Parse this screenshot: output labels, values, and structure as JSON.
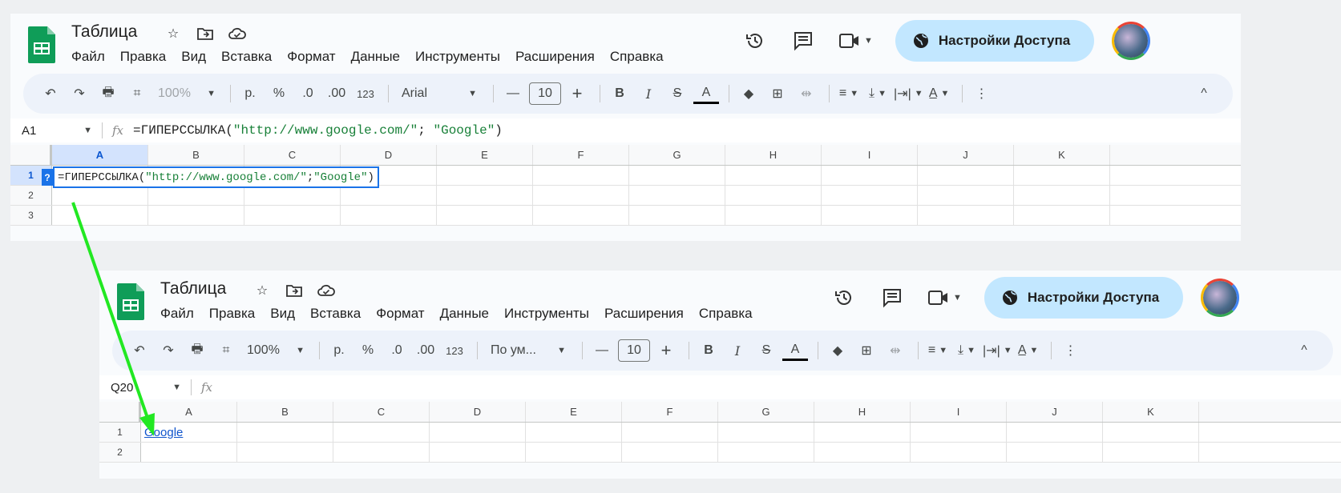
{
  "top_panel": {
    "doc_title": "Таблица",
    "menu": [
      "Файл",
      "Правка",
      "Вид",
      "Вставка",
      "Формат",
      "Данные",
      "Инструменты",
      "Расширения",
      "Справка"
    ],
    "share_label": "Настройки Доступа",
    "toolbar": {
      "zoom": "100%",
      "currency": "р.",
      "percent": "%",
      "dec_less": ".0",
      "dec_more": ".00",
      "num_format": "123",
      "font": "Arial",
      "font_size": "10"
    },
    "name_box": "A1",
    "formula_fn": "=ГИПЕРССЫЛКА(",
    "formula_arg1": "\"http://www.google.com/\"",
    "formula_sep": "; ",
    "formula_arg2": "\"Google\"",
    "formula_close": ")",
    "columns": [
      "A",
      "B",
      "C",
      "D",
      "E",
      "F",
      "G",
      "H",
      "I",
      "J",
      "K"
    ],
    "rows": [
      "1",
      "2",
      "3"
    ],
    "edit_badge": "?"
  },
  "bottom_panel": {
    "doc_title": "Таблица",
    "menu": [
      "Файл",
      "Правка",
      "Вид",
      "Вставка",
      "Формат",
      "Данные",
      "Инструменты",
      "Расширения",
      "Справка"
    ],
    "share_label": "Настройки Доступа",
    "toolbar": {
      "zoom": "100%",
      "currency": "р.",
      "percent": "%",
      "dec_less": ".0",
      "dec_more": ".00",
      "num_format": "123",
      "font": "По ум...",
      "font_size": "10"
    },
    "name_box": "Q20",
    "columns": [
      "A",
      "B",
      "C",
      "D",
      "E",
      "F",
      "G",
      "H",
      "I",
      "J",
      "K"
    ],
    "rows": [
      "1",
      "2"
    ],
    "cell_a1": "Google"
  },
  "colors": {
    "arrow": "#22e822",
    "share_bg": "#c2e7ff",
    "selection": "#1a73e8",
    "sheets_green": "#0f9d58"
  },
  "icons": [
    "sheets-logo-icon",
    "star-icon",
    "move-to-folder-icon",
    "cloud-saved-icon",
    "history-icon",
    "comments-icon",
    "video-call-icon",
    "globe-icon",
    "undo-icon",
    "redo-icon",
    "print-icon",
    "paint-format-icon",
    "bold-icon",
    "italic-icon",
    "strikethrough-icon",
    "text-color-icon",
    "fill-color-icon",
    "borders-icon",
    "merge-cells-icon",
    "align-icon",
    "valign-icon",
    "wrap-icon",
    "rotate-icon",
    "more-icon",
    "collapse-icon",
    "dropdown-icon"
  ]
}
